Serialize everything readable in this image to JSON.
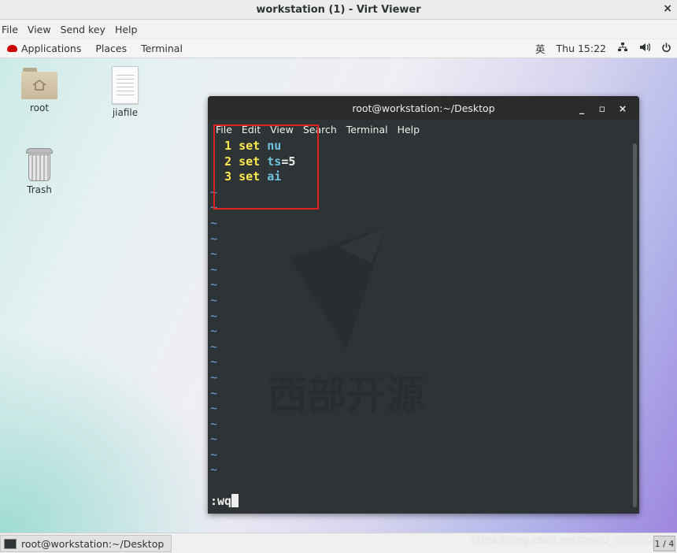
{
  "window": {
    "title": "workstation (1) - Virt Viewer",
    "close": "×",
    "menu": [
      "File",
      "View",
      "Send key",
      "Help"
    ]
  },
  "top_panel": {
    "applications": "Applications",
    "places": "Places",
    "terminal": "Terminal",
    "input_method": "英",
    "clock": "Thu 15:22",
    "network_icon": "network-icon",
    "volume_icon": "volume-icon",
    "power_icon": "power-icon"
  },
  "desktop": {
    "icons": [
      {
        "label": "root",
        "icon": "home-folder-icon"
      },
      {
        "label": "jiafile",
        "icon": "text-file-icon"
      },
      {
        "label": "Trash",
        "icon": "trash-icon"
      }
    ]
  },
  "terminal": {
    "title": "root@workstation:~/Desktop",
    "buttons": {
      "minimize": "_",
      "maximize": "▫",
      "close": "×"
    },
    "menu": [
      "File",
      "Edit",
      "View",
      "Search",
      "Terminal",
      "Help"
    ],
    "lines": [
      {
        "num": "1",
        "kw": "set",
        "opt": "nu",
        "rest": ""
      },
      {
        "num": "2",
        "kw": "set",
        "opt": "ts",
        "rest": "=5"
      },
      {
        "num": "3",
        "kw": "set",
        "opt": "ai",
        "rest": ""
      }
    ],
    "tilde": "~",
    "command": ":wq",
    "watermark": "西部开源"
  },
  "taskbar": {
    "task_label": "root@workstation:~/Desktop",
    "workspace": "1 / 4",
    "csdn_watermark": "https://blog.csdn.net/baidu_40389082"
  }
}
